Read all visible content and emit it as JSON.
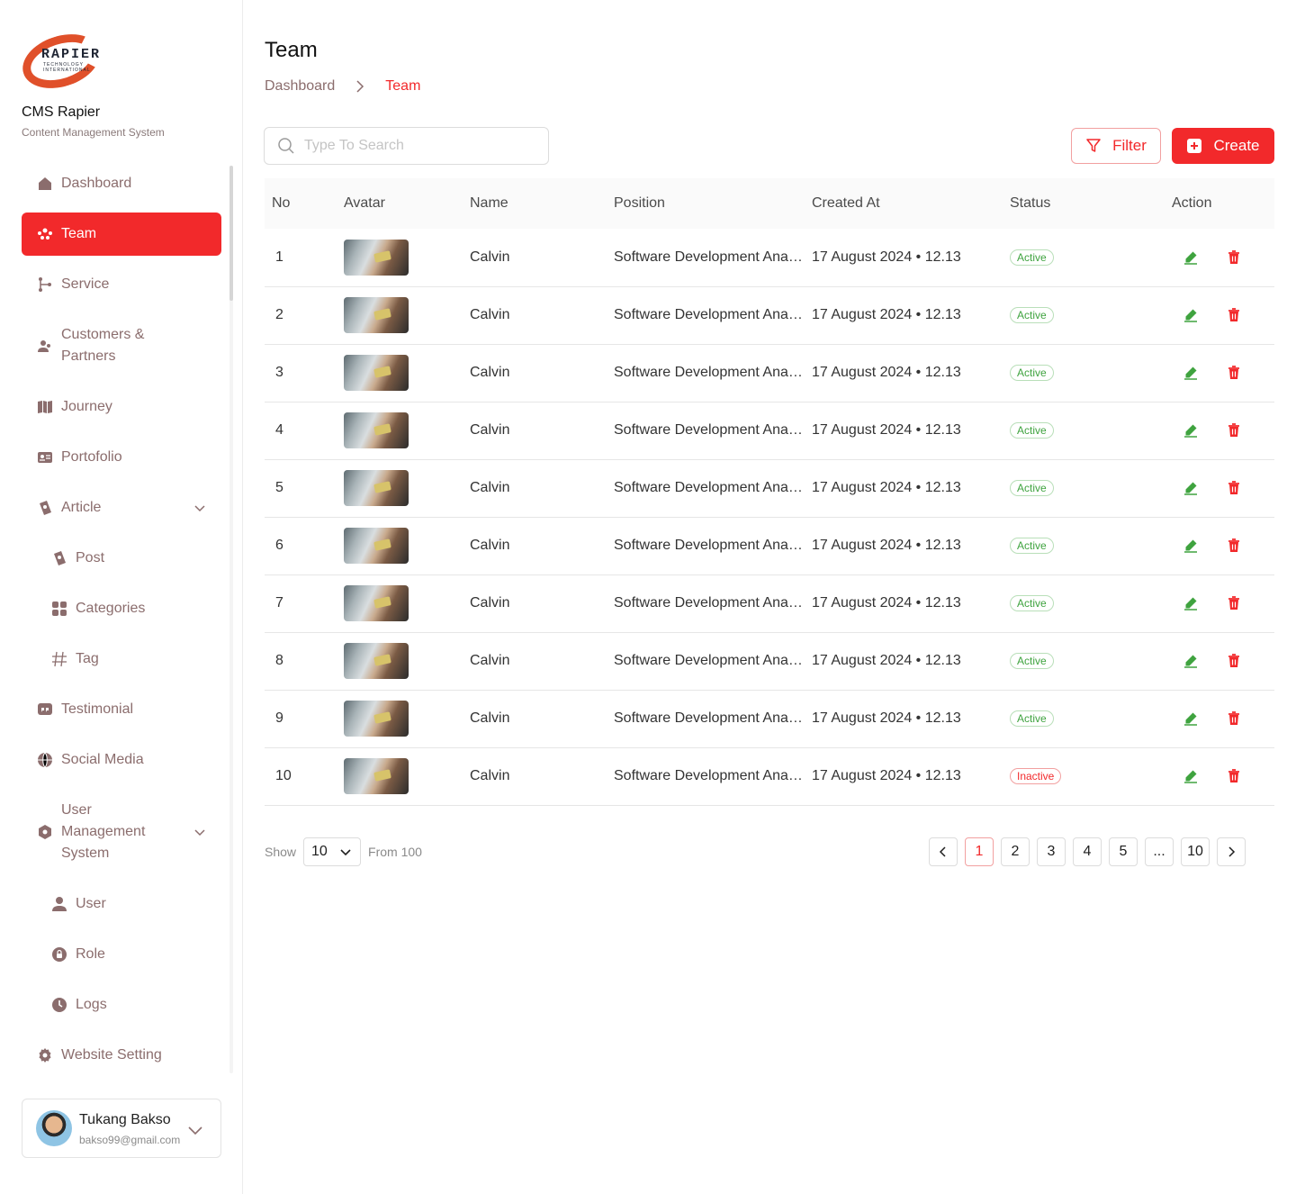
{
  "brand": {
    "logo_text": "RAPIER",
    "logo_sub": "TECHNOLOGY INTERNATIONAL",
    "name": "CMS Rapier",
    "subtitle": "Content Management System"
  },
  "sidebar": {
    "items": [
      {
        "label": "Dashboard",
        "icon": "home-icon"
      },
      {
        "label": "Team",
        "icon": "team-icon",
        "active": true
      },
      {
        "label": "Service",
        "icon": "service-icon"
      },
      {
        "label": "Customers & Partners",
        "icon": "customers-icon"
      },
      {
        "label": "Journey",
        "icon": "map-icon"
      },
      {
        "label": "Portofolio",
        "icon": "id-card-icon"
      },
      {
        "label": "Article",
        "icon": "article-icon",
        "expandable": true
      },
      {
        "label": "Post",
        "icon": "post-icon",
        "sub": true
      },
      {
        "label": "Categories",
        "icon": "grid-icon",
        "sub": true
      },
      {
        "label": "Tag",
        "icon": "hash-icon",
        "sub": true
      },
      {
        "label": "Testimonial",
        "icon": "quote-icon"
      },
      {
        "label": "Social Media",
        "icon": "globe-icon"
      },
      {
        "label": "User Management System",
        "icon": "shield-icon",
        "expandable": true
      },
      {
        "label": "User",
        "icon": "user-icon",
        "sub": true
      },
      {
        "label": "Role",
        "icon": "lock-icon",
        "sub": true
      },
      {
        "label": "Logs",
        "icon": "clock-icon",
        "sub": true
      },
      {
        "label": "Website Setting",
        "icon": "gear-icon"
      }
    ]
  },
  "user": {
    "name": "Tukang Bakso",
    "email": "bakso99@gmail.com"
  },
  "page": {
    "title": "Team",
    "breadcrumb": {
      "home": "Dashboard",
      "current": "Team"
    }
  },
  "search": {
    "placeholder": "Type To Search"
  },
  "toolbar": {
    "filter_label": "Filter",
    "create_label": "Create"
  },
  "table": {
    "headers": [
      "No",
      "Avatar",
      "Name",
      "Position",
      "Created At",
      "Status",
      "Action"
    ],
    "rows": [
      {
        "no": "1",
        "name": "Calvin",
        "position": "Software Development Analyst",
        "created": "17 August 2024 • 12.13",
        "status": "Active"
      },
      {
        "no": "2",
        "name": "Calvin",
        "position": "Software Development Analyst",
        "created": "17 August 2024 • 12.13",
        "status": "Active"
      },
      {
        "no": "3",
        "name": "Calvin",
        "position": "Software Development Analyst",
        "created": "17 August 2024 • 12.13",
        "status": "Active"
      },
      {
        "no": "4",
        "name": "Calvin",
        "position": "Software Development Analyst",
        "created": "17 August 2024 • 12.13",
        "status": "Active"
      },
      {
        "no": "5",
        "name": "Calvin",
        "position": "Software Development Analyst",
        "created": "17 August 2024 • 12.13",
        "status": "Active"
      },
      {
        "no": "6",
        "name": "Calvin",
        "position": "Software Development Analyst",
        "created": "17 August 2024 • 12.13",
        "status": "Active"
      },
      {
        "no": "7",
        "name": "Calvin",
        "position": "Software Development Analyst",
        "created": "17 August 2024 • 12.13",
        "status": "Active"
      },
      {
        "no": "8",
        "name": "Calvin",
        "position": "Software Development Analyst",
        "created": "17 August 2024 • 12.13",
        "status": "Active"
      },
      {
        "no": "9",
        "name": "Calvin",
        "position": "Software Development Analyst",
        "created": "17 August 2024 • 12.13",
        "status": "Active"
      },
      {
        "no": "10",
        "name": "Calvin",
        "position": "Software Development Analyst",
        "created": "17 August 2024 • 12.13",
        "status": "Inactive"
      }
    ]
  },
  "pagination": {
    "show_label": "Show",
    "per_page": "10",
    "from_label": "From 100",
    "pages": [
      "1",
      "2",
      "3",
      "4",
      "5",
      "...",
      "10"
    ],
    "current": "1"
  },
  "colors": {
    "accent": "#f2292b",
    "muted": "#8b6d6d",
    "active_status": "#3fa33f",
    "edit_icon": "#3fa33f"
  }
}
